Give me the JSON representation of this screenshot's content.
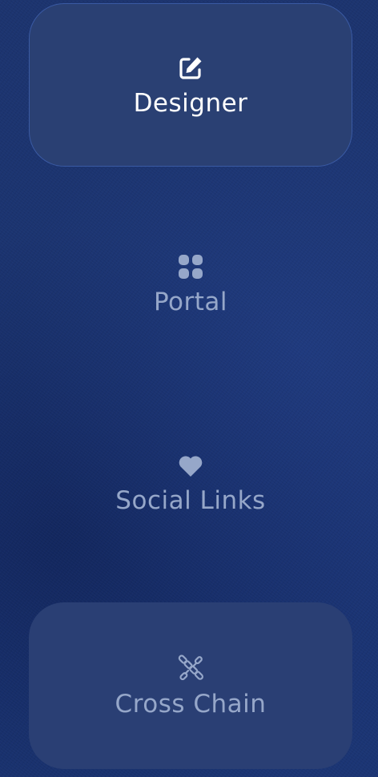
{
  "nav": {
    "items": [
      {
        "label": "Designer",
        "icon": "edit-icon",
        "state": "active"
      },
      {
        "label": "Portal",
        "icon": "grid-icon",
        "state": "default"
      },
      {
        "label": "Social Links",
        "icon": "heart-icon",
        "state": "default"
      },
      {
        "label": "Cross Chain",
        "icon": "broken-chain-icon",
        "state": "hover"
      }
    ]
  },
  "colors": {
    "background": "#1b3471",
    "active_bg": "#2a4073",
    "active_border": "#3a5aa3",
    "active_text": "#ffffff",
    "inactive_text": "#96a7c9"
  }
}
